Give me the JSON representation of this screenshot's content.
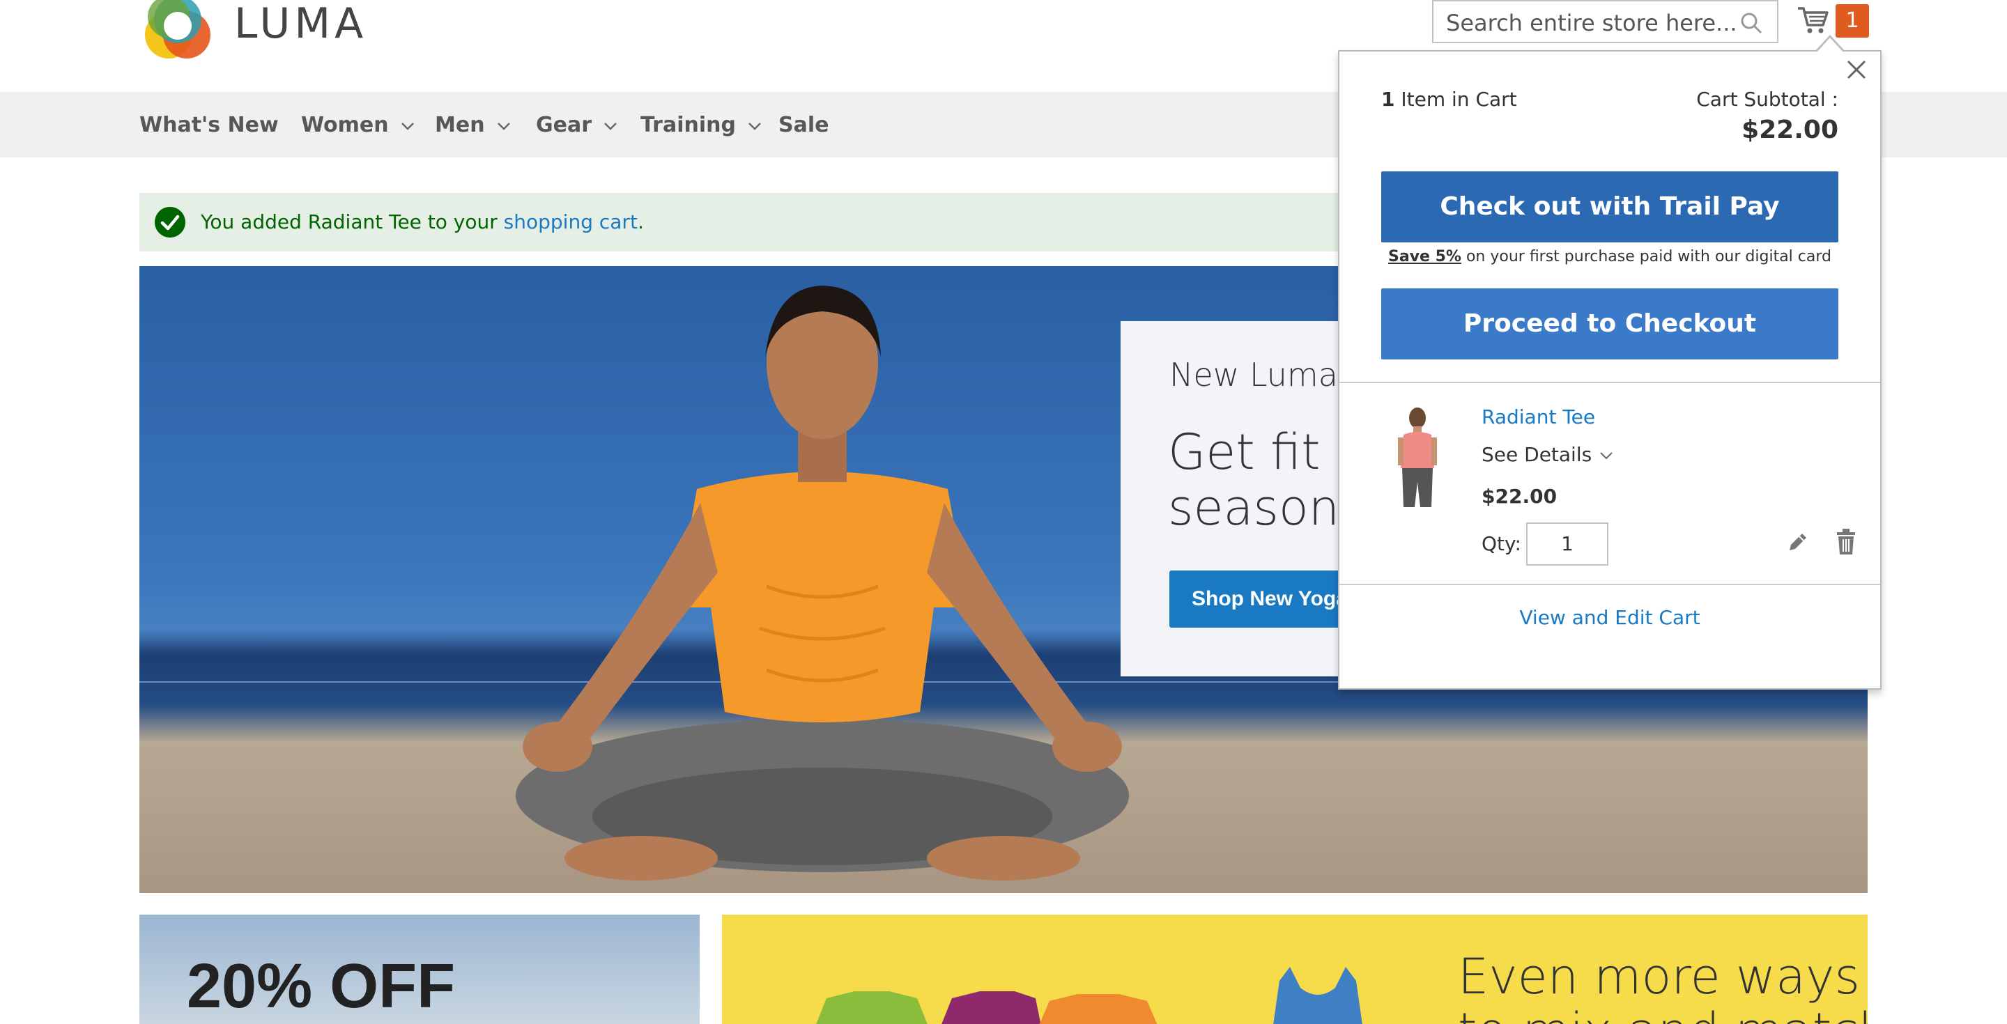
{
  "header": {
    "logo_text": "LUMA",
    "search_placeholder": "Search entire store here...",
    "cart_count": "1"
  },
  "nav": {
    "items": [
      {
        "label": "What's New",
        "has_dropdown": false
      },
      {
        "label": "Women",
        "has_dropdown": true
      },
      {
        "label": "Men",
        "has_dropdown": true
      },
      {
        "label": "Gear",
        "has_dropdown": true
      },
      {
        "label": "Training",
        "has_dropdown": true
      },
      {
        "label": "Sale",
        "has_dropdown": false
      }
    ]
  },
  "message": {
    "text_before": "You added Radiant Tee to your ",
    "link": "shopping cart",
    "text_after": "."
  },
  "hero": {
    "subtitle": "New Luma Y",
    "title_line1": "Get fit ar",
    "title_line2": "seasona",
    "button": "Shop New Yoga"
  },
  "promos": {
    "left": "20% OFF",
    "right_line1": "Even more ways",
    "right_line2": "to mix and match"
  },
  "minicart": {
    "count_number": "1",
    "count_label": "Item in Cart",
    "subtotal_label": "Cart Subtotal :",
    "subtotal": "$22.00",
    "trail_pay_button": "Check out with Trail Pay",
    "save_bold": "Save 5%",
    "save_rest": " on your first purchase paid with our digital card",
    "checkout_button": "Proceed to Checkout",
    "item": {
      "name": "Radiant Tee",
      "details_label": "See Details",
      "price": "$22.00",
      "qty_label": "Qty:",
      "qty": "1"
    },
    "view_edit": "View and Edit Cart"
  },
  "colors": {
    "accent_blue": "#1979c3",
    "cart_badge": "#e05b20",
    "success_green": "#006400",
    "trail_pay_button": "#2c69b3",
    "checkout_button": "#3a7ac8"
  },
  "icons": [
    "luma-logo-icon",
    "search-icon",
    "cart-icon",
    "chevron-down-icon",
    "checkmark-icon",
    "close-icon",
    "edit-icon",
    "trash-icon"
  ]
}
